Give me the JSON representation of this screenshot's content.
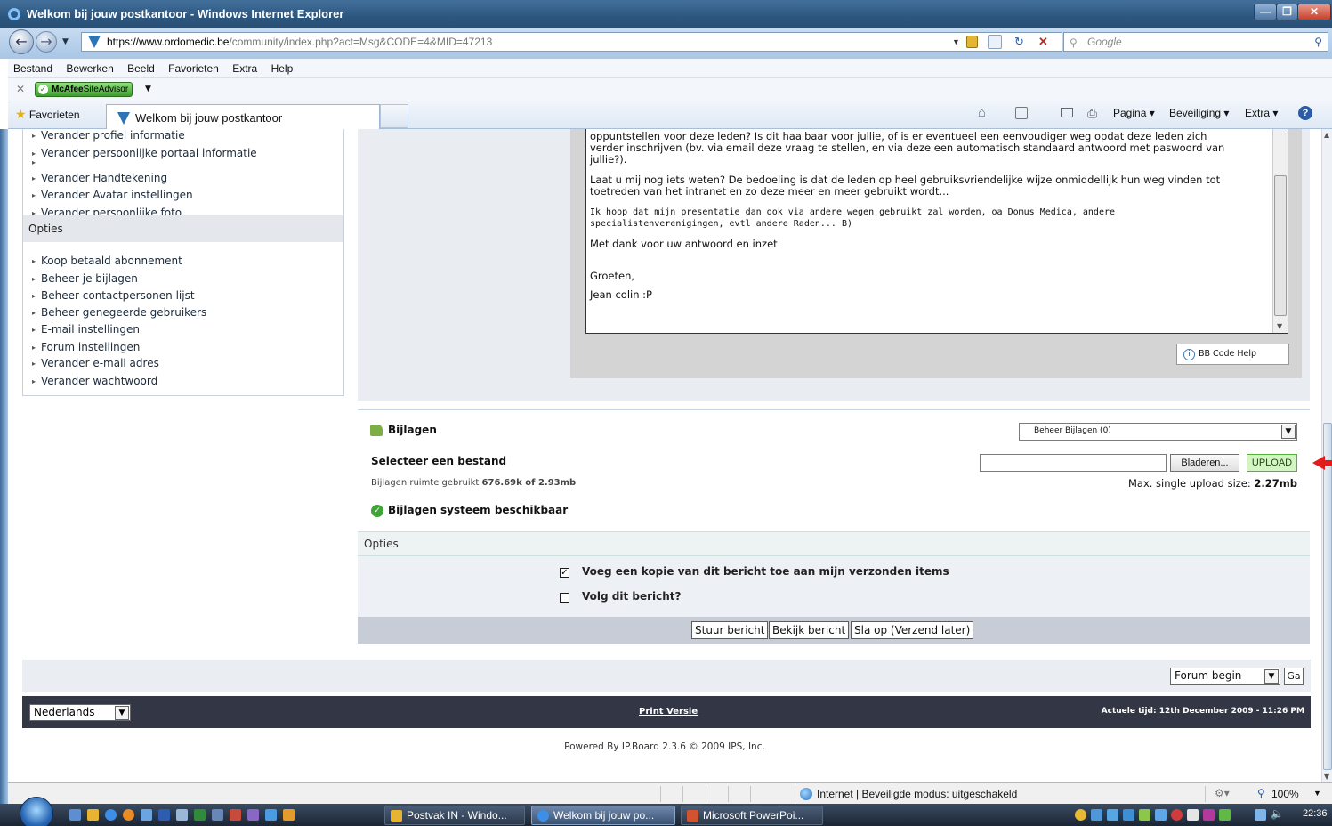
{
  "window": {
    "title": "Welkom bij jouw postkantoor - Windows Internet Explorer"
  },
  "address": {
    "url_proto": "https://",
    "url_host": "www.ordomedic.be",
    "url_path": "/community/index.php?act=Msg&CODE=4&MID=47213",
    "search_placeholder": "Google"
  },
  "menu": [
    "Bestand",
    "Bewerken",
    "Beeld",
    "Favorieten",
    "Extra",
    "Help"
  ],
  "mcafee": {
    "brand": "McAfee",
    "label": "SiteAdvisor"
  },
  "tabs": {
    "favorites": "Favorieten",
    "active_tab": "Welkom bij jouw postkantoor",
    "commands": [
      "Pagina ▾",
      "Beveiliging ▾",
      "Extra ▾"
    ]
  },
  "sidebar": {
    "links_top": [
      "Verander profiel informatie",
      "Verander persoonlijke portaal informatie",
      "",
      "Verander Handtekening",
      "Verander Avatar instellingen",
      "Verander persoonlijke foto"
    ],
    "opties_title": "Opties",
    "links_opties": [
      "Koop betaald abonnement",
      "Beheer je bijlagen",
      "Beheer contactpersonen lijst",
      "Beheer genegeerde gebruikers",
      "E-mail instellingen",
      "Forum instellingen",
      "Verander e-mail adres",
      "Verander wachtwoord"
    ]
  },
  "message": {
    "paragraphs": [
      "oppuntstellen voor deze leden? Is dit haalbaar voor jullie, of is er eventueel een eenvoudiger weg opdat deze leden zich\nverder inschrijven (bv. via email deze vraag te stellen, en via deze een automatisch standaard antwoord met paswoord van\njullie?).",
      "Laat u mij nog iets weten? De bedoeling is dat de leden op heel gebruiksvriendelijke wijze onmiddellijk hun weg vinden tot\ntoetreden van het intranet en zo deze meer en meer gebruikt wordt...",
      "Ik hoop dat mijn presentatie dan ook via andere wegen gebruikt zal worden, oa Domus Medica, andere\nspecialistenverenigingen, evtl andere Raden... B)",
      "Met dank voor uw antwoord en inzet",
      "\nGroeten,",
      "Jean colin :P"
    ],
    "bbcode_help": "BB Code Help"
  },
  "attachments": {
    "title": "Bijlagen",
    "manage_select": "Beheer Bijlagen (0)",
    "select_file_label": "Selecteer een bestand",
    "browse_label": "Bladeren...",
    "upload_label": "UPLOAD",
    "space_used_prefix": "Bijlagen ruimte gebruikt ",
    "space_used_value": "676.69k of 2.93mb",
    "max_size_prefix": "Max. single upload size: ",
    "max_size_value": "2.27mb",
    "system_status": "Bijlagen systeem beschikbaar"
  },
  "options": {
    "title": "Opties",
    "save_copy_label": "Voeg een kopie van dit bericht toe aan mijn verzonden items",
    "save_copy_checked": true,
    "track_label": "Volg dit bericht?",
    "track_checked": false
  },
  "actions": {
    "send": "Stuur bericht",
    "preview": "Bekijk bericht",
    "save": "Sla op (Verzend later)"
  },
  "forum_nav": {
    "selected": "Forum begin",
    "go": "Ga"
  },
  "footer": {
    "language": "Nederlands",
    "print": "Print Versie",
    "time": "Actuele tijd: 12th December 2009 - 11:26 PM",
    "powered": "Powered By IP.Board 2.3.6 © 2009  IPS, Inc."
  },
  "status": {
    "zone": "Internet | Beveiligde modus: uitgeschakeld",
    "zoom": "100%"
  },
  "taskbar": {
    "tasks": [
      "Postvak IN - Windo...",
      "Welkom bij jouw po...",
      "Microsoft PowerPoi..."
    ],
    "clock": "22:36"
  },
  "colors": {
    "titlebar": "#2c5780",
    "upload_green": "#d3f5c3",
    "footer_dark": "#333745",
    "annotation_red": "#e41b1b"
  }
}
